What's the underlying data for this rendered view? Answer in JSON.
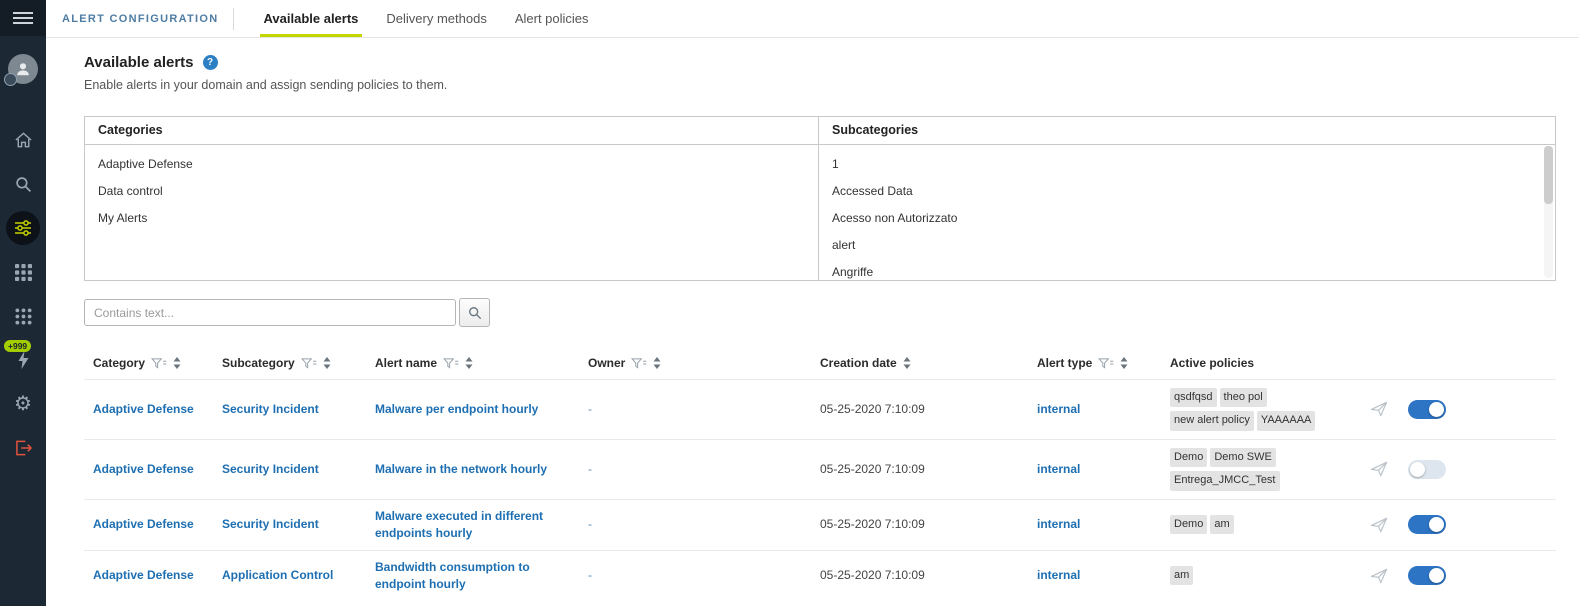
{
  "header": {
    "title": "ALERT CONFIGURATION",
    "tabs": [
      {
        "label": "Available alerts",
        "active": true
      },
      {
        "label": "Delivery methods",
        "active": false
      },
      {
        "label": "Alert policies",
        "active": false
      }
    ]
  },
  "sidebar": {
    "notification_badge": "+999",
    "icons": [
      "hamburger-icon",
      "avatar",
      "home-icon",
      "search-icon",
      "sliders-icon",
      "grid-icon",
      "modules-grid-icon",
      "lightning-icon",
      "gear-icon",
      "logout-icon"
    ]
  },
  "page": {
    "title": "Available alerts",
    "subtitle": "Enable alerts in your domain and assign sending policies to them."
  },
  "panels": {
    "categories": {
      "title": "Categories",
      "items": [
        "Adaptive Defense",
        "Data control",
        "My Alerts"
      ]
    },
    "subcategories": {
      "title": "Subcategories",
      "items": [
        "1",
        "Accessed Data",
        "Acesso non Autorizzato",
        "alert",
        "Angriffe"
      ]
    }
  },
  "search": {
    "placeholder": "Contains text..."
  },
  "table": {
    "columns": [
      {
        "label": "Category",
        "filter": true,
        "sort": true
      },
      {
        "label": "Subcategory",
        "filter": true,
        "sort": true
      },
      {
        "label": "Alert name",
        "filter": true,
        "sort": true
      },
      {
        "label": "Owner",
        "filter": true,
        "sort": true
      },
      {
        "label": "Creation date",
        "filter": false,
        "sort": true
      },
      {
        "label": "Alert type",
        "filter": true,
        "sort": true
      },
      {
        "label": "Active policies",
        "filter": false,
        "sort": false
      }
    ],
    "rows": [
      {
        "category": "Adaptive Defense",
        "subcategory": "Security Incident",
        "alert_name": "Malware per endpoint hourly",
        "owner": "-",
        "creation_date": "05-25-2020 7:10:09",
        "alert_type": "internal",
        "policies": [
          "qsdfqsd",
          "theo pol",
          "new alert policy",
          "YAAAAAA"
        ],
        "enabled": true
      },
      {
        "category": "Adaptive Defense",
        "subcategory": "Security Incident",
        "alert_name": "Malware in the network hourly",
        "owner": "-",
        "creation_date": "05-25-2020 7:10:09",
        "alert_type": "internal",
        "policies": [
          "Demo",
          "Demo SWE",
          "Entrega_JMCC_Test"
        ],
        "enabled": false
      },
      {
        "category": "Adaptive Defense",
        "subcategory": "Security Incident",
        "alert_name": "Malware executed in different endpoints hourly",
        "owner": "-",
        "creation_date": "05-25-2020 7:10:09",
        "alert_type": "internal",
        "policies": [
          "Demo",
          "am"
        ],
        "enabled": true
      },
      {
        "category": "Adaptive Defense",
        "subcategory": "Application Control",
        "alert_name": "Bandwidth consumption to endpoint hourly",
        "owner": "-",
        "creation_date": "05-25-2020 7:10:09",
        "alert_type": "internal",
        "policies": [
          "am"
        ],
        "enabled": true
      }
    ]
  },
  "colors": {
    "accent": "#c3d600",
    "link": "#1e6fb2",
    "toggle_on": "#2d74c4",
    "sidebar_bg": "#1d2835",
    "title_blue": "#4e7ca3",
    "logout_red": "#e05240",
    "tag_bg": "#e3e3e3"
  }
}
